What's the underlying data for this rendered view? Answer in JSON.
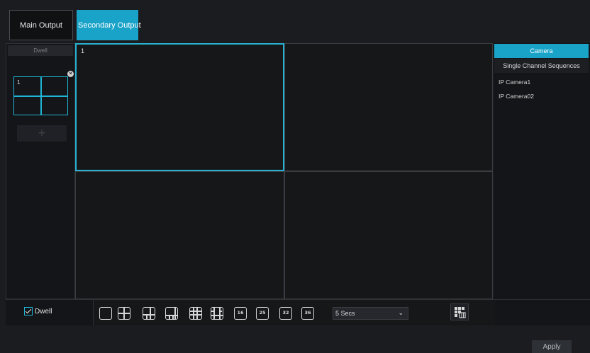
{
  "tabs": {
    "main_output": "Main Output",
    "secondary_output": "Secondary Output"
  },
  "left_panel": {
    "dwell_header": "Dwell",
    "layout_thumb_number": "1",
    "add_symbol": "+"
  },
  "grid": {
    "cells": [
      "1",
      "",
      "",
      ""
    ]
  },
  "right_panel": {
    "tabs": [
      "Camera",
      "Single Channel Sequences"
    ],
    "cameras": [
      "IP Camera1",
      "IP Camera02"
    ]
  },
  "bottom": {
    "dwell_label": "Dwell",
    "dwell_checked": true,
    "layout_buttons": [
      "1",
      "4",
      "6",
      "8",
      "9",
      "10",
      "16",
      "25",
      "32",
      "36"
    ],
    "layout_labels": {
      "l16": "16",
      "l25": "25",
      "l32": "32",
      "l36": "36"
    },
    "interval_value": "5 Secs"
  },
  "footer": {
    "apply_label": "Apply"
  },
  "colors": {
    "accent": "#1aa3c8",
    "selected_border": "#28b1d0",
    "background": "#1b1c1f"
  },
  "icons": [
    "close-icon",
    "plus-icon",
    "checkbox-icon",
    "chevron-down-icon",
    "custom-layout-icon"
  ]
}
